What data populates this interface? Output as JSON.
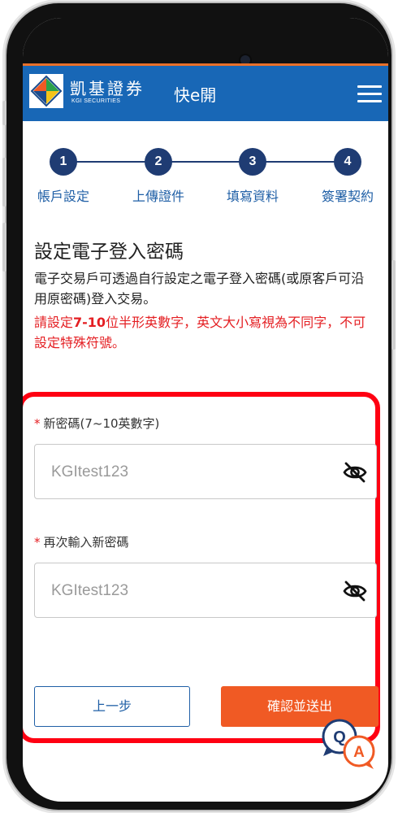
{
  "app": {
    "brand_cn": "凱基證券",
    "brand_en": "KGI SECURITIES",
    "title": "快e開"
  },
  "steps": [
    {
      "num": "1",
      "label": "帳戶設定"
    },
    {
      "num": "2",
      "label": "上傳證件"
    },
    {
      "num": "3",
      "label": "填寫資料"
    },
    {
      "num": "4",
      "label": "簽署契約"
    }
  ],
  "section": {
    "title": "設定電子登入密碼",
    "desc": "電子交易戶可透過自行設定之電子登入密碼(或原客戶可沿用原密碼)登入交易。",
    "warn_prefix": "請設定",
    "warn_bold": "7-10",
    "warn_suffix": "位半形英數字，英文大小寫視為不同字，不可設定特殊符號。"
  },
  "form": {
    "new_password": {
      "required_mark": "*",
      "label": "新密碼(7~10英數字)",
      "value": "KGItest123"
    },
    "confirm_password": {
      "required_mark": "*",
      "label": "再次輸入新密碼",
      "value": "KGItest123"
    }
  },
  "buttons": {
    "prev": "上一步",
    "next": "確認並送出"
  },
  "qa": {
    "q": "Q",
    "a": "A"
  },
  "colors": {
    "header_blue": "#1867b6",
    "accent_orange": "#f05a24",
    "step_navy": "#1f3c73",
    "warning_red": "#e41e22",
    "highlight_frame": "#ff0012"
  }
}
